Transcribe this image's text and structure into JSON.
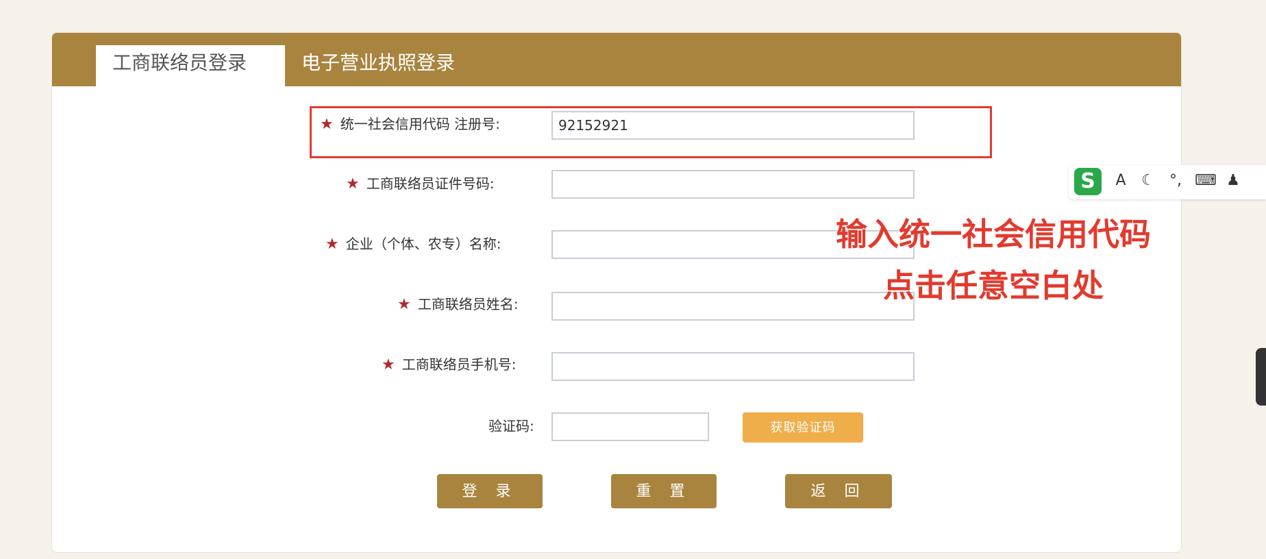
{
  "tabs": [
    {
      "label": "工商联络员登录"
    },
    {
      "label": "电子营业执照登录"
    }
  ],
  "form": {
    "required_mark": "★",
    "fields": [
      {
        "label": "统一社会信用代码 注册号:",
        "value": "92152921"
      },
      {
        "label": "工商联络员证件号码:",
        "value": ""
      },
      {
        "label": "企业（个体、农专）名称:",
        "value": ""
      },
      {
        "label": "工商联络员姓名:",
        "value": ""
      },
      {
        "label": "工商联络员手机号:",
        "value": ""
      }
    ],
    "captcha": {
      "label": "验证码:",
      "value": "",
      "button_label": "获取验证码"
    }
  },
  "buttons": {
    "login": "登 录",
    "reset": "重 置",
    "back": "返 回"
  },
  "annotation": {
    "line1": "输入统一社会信用代码",
    "line2": "点击任意空白处"
  },
  "ime": {
    "logo": "S",
    "icons": [
      "font-icon",
      "moon-icon",
      "punctuation-icon",
      "keyboard-icon",
      "user-icon"
    ],
    "glyphs": [
      "A",
      "☾",
      "°,",
      "⌨",
      "♟"
    ]
  },
  "colors": {
    "accent": "#a8843f",
    "highlight": "#e23a2e",
    "secondary_button": "#efae4a",
    "background": "#f4f2ea"
  }
}
